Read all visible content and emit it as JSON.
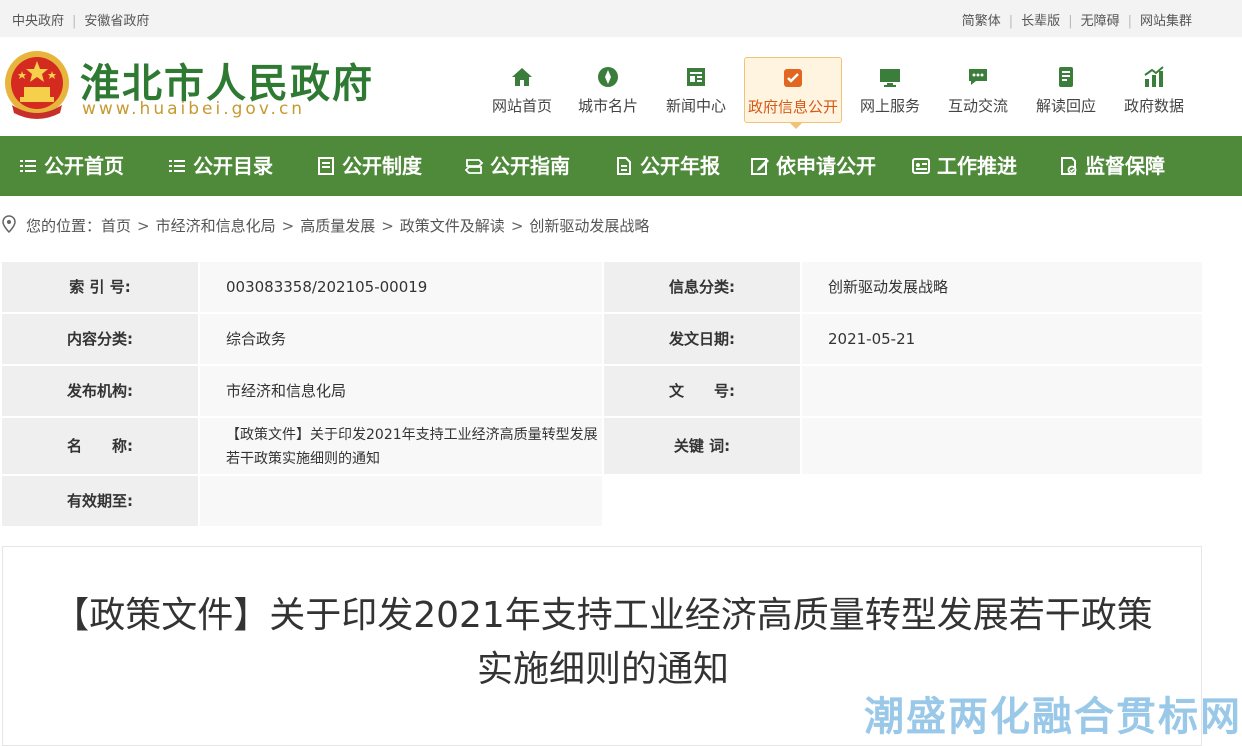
{
  "topbar": {
    "left_links": [
      "中央政府",
      "安徽省政府"
    ],
    "right_links": [
      "简繁体",
      "长辈版",
      "无障碍",
      "网站集群"
    ]
  },
  "header": {
    "title": "淮北市人民政府",
    "url": "www.huaibei.gov.cn",
    "nav": [
      {
        "label": "网站首页",
        "icon": "home-icon"
      },
      {
        "label": "城市名片",
        "icon": "compass-icon"
      },
      {
        "label": "新闻中心",
        "icon": "news-icon"
      },
      {
        "label": "政府信息公开",
        "icon": "open-info-icon",
        "active": true
      },
      {
        "label": "网上服务",
        "icon": "monitor-icon"
      },
      {
        "label": "互动交流",
        "icon": "chat-icon"
      },
      {
        "label": "解读回应",
        "icon": "document-icon"
      },
      {
        "label": "政府数据",
        "icon": "chart-icon"
      }
    ]
  },
  "greennav": {
    "items": [
      {
        "label": "公开首页",
        "icon": "list-icon"
      },
      {
        "label": "公开目录",
        "icon": "list-icon"
      },
      {
        "label": "公开制度",
        "icon": "doc-list-icon"
      },
      {
        "label": "公开指南",
        "icon": "signpost-icon"
      },
      {
        "label": "公开年报",
        "icon": "report-icon"
      },
      {
        "label": "依申请公开",
        "icon": "edit-icon"
      },
      {
        "label": "工作推进",
        "icon": "id-card-icon"
      },
      {
        "label": "监督保障",
        "icon": "shield-doc-icon"
      }
    ]
  },
  "breadcrumb": {
    "prefix": "您的位置：",
    "items": [
      "首页",
      "市经济和信息化局",
      "高质量发展",
      "政策文件及解读",
      "创新驱动发展战略"
    ],
    "separator": ">"
  },
  "meta": {
    "index_label": "索 引 号:",
    "index_value": "003083358/202105-00019",
    "info_cat_label": "信息分类:",
    "info_cat_value": "创新驱动发展战略",
    "content_cat_label": "内容分类:",
    "content_cat_value": "综合政务",
    "date_label": "发文日期:",
    "date_value": "2021-05-21",
    "org_label": "发布机构:",
    "org_value": "市经济和信息化局",
    "docno_label": "文　　号:",
    "docno_value": "",
    "name_label": "名　　称:",
    "name_value": "【政策文件】关于印发2021年支持工业经济高质量转型发展若干政策实施细则的通知",
    "keyword_label": "关键 词:",
    "keyword_value": "",
    "valid_label": "有效期至:",
    "valid_value": ""
  },
  "document": {
    "title": "【政策文件】关于印发2021年支持工业经济高质量转型发展若干政策实施细则的通知"
  },
  "watermark": "潮盛两化融合贯标网",
  "colors": {
    "green": "#4f8a3b",
    "title_green": "#2f7a33",
    "active_orange": "#d65a17"
  }
}
